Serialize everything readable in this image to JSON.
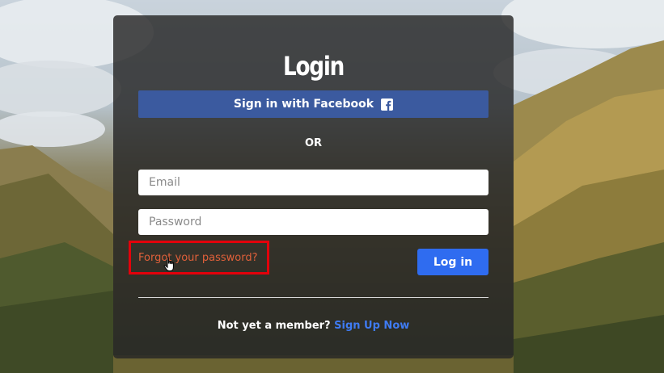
{
  "login": {
    "title": "Login",
    "facebook_button": "Sign in with Facebook",
    "facebook_icon": "facebook-icon",
    "or_text": "OR",
    "email_placeholder": "Email",
    "password_placeholder": "Password",
    "forgot_password": "Forgot your password?",
    "login_button": "Log in",
    "not_member_text": "Not yet a member?",
    "signup_link": "Sign Up Now"
  },
  "colors": {
    "facebook_blue": "#3b5a9f",
    "login_blue": "#2f6cf0",
    "forgot_orange": "#e0603a",
    "highlight_red": "#e3000b",
    "signup_link_blue": "#3f7bf2"
  }
}
